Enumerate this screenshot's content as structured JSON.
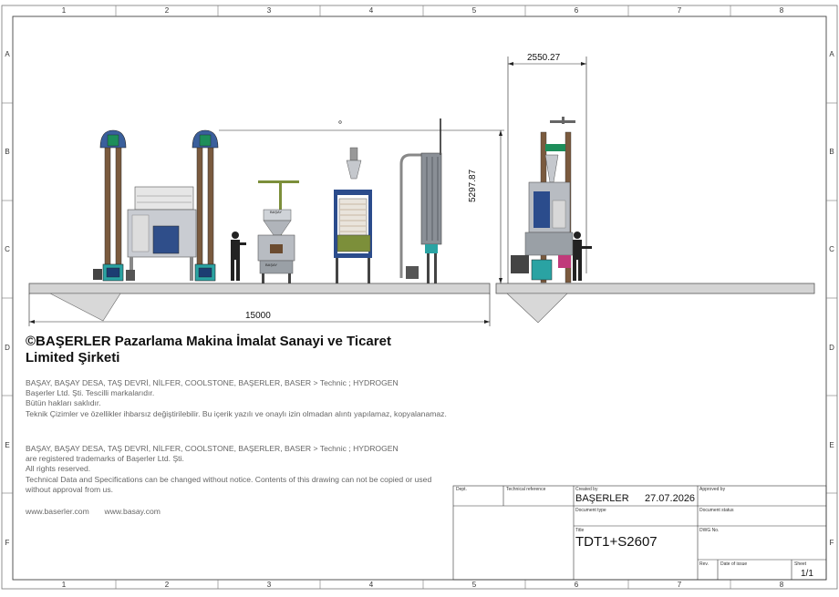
{
  "frame": {
    "col_labels": [
      "1",
      "2",
      "3",
      "4",
      "5",
      "6",
      "7",
      "8"
    ],
    "row_labels": [
      "A",
      "B",
      "C",
      "D",
      "E",
      "F"
    ]
  },
  "dimensions": {
    "width": "2550.27",
    "height": "5297.87",
    "length": "15000"
  },
  "company": {
    "name_line1": "©BAŞERLER Pazarlama Makina İmalat Sanayi ve Ticaret",
    "name_line2": "Limited Şirketi"
  },
  "legal_tr": {
    "line1": "BAŞAY, BAŞAY DESA, TAŞ DEVRİ, NİLFER, COOLSTONE, BAŞERLER, BASER > Technic ; HYDROGEN",
    "line2": "Başerler Ltd. Şti. Tescilli markalarıdır.",
    "line3": "Bütün hakları saklıdır.",
    "line4": "Teknik Çizimler ve özellikler ihbarsız değiştirilebilir. Bu içerik yazılı ve onaylı izin olmadan alıntı yapılamaz, kopyalanamaz."
  },
  "legal_en": {
    "line1": "BAŞAY, BAŞAY DESA, TAŞ DEVRİ, NİLFER, COOLSTONE, BAŞERLER, BASER > Technic ; HYDROGEN",
    "line2": "are registered trademarks of Başerler Ltd. Şti.",
    "line3": "All rights reserved.",
    "line4": "Technical Data and Specifications can be changed without notice. Contents of this drawing can not be copied or used without approval from us."
  },
  "websites": {
    "site1": "www.baserler.com",
    "site2": "www.basay.com"
  },
  "title_block": {
    "dept_label": "Dept.",
    "tech_ref_label": "Technical reference",
    "created_by_label": "Created by",
    "created_by": "BAŞERLER",
    "date": "27.07.2026",
    "approved_by_label": "Approved by",
    "doc_type_label": "Document type",
    "doc_status_label": "Document status",
    "title_label": "Title",
    "title": "TDT1+S2607",
    "dwg_no_label": "DWG No.",
    "rev_label": "Rev.",
    "date_of_issue_label": "Date of issue",
    "sheet_label": "Sheet",
    "sheet": "1/1"
  },
  "machine_labels": {
    "hopper_brand": "BAŞAY",
    "press_brand": "BAŞAY"
  },
  "colors": {
    "frame": "#555555",
    "elevator_blue": "#2b4c8c",
    "steel": "#b8bcc2",
    "teal": "#2aa3a3",
    "floor": "#c8c8c8"
  }
}
